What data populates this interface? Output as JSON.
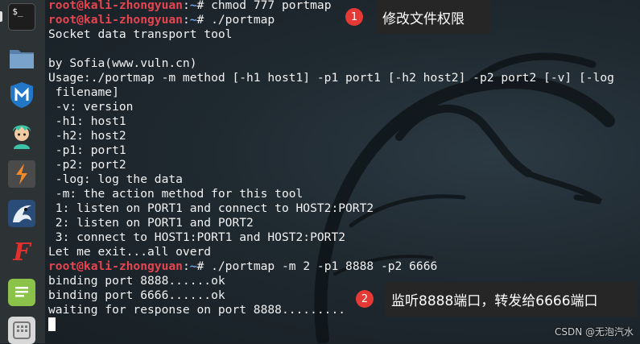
{
  "dock": {
    "items": [
      {
        "name": "terminal-icon",
        "label": "$_"
      },
      {
        "name": "folder-icon"
      },
      {
        "name": "metasploit-icon"
      },
      {
        "name": "avatar-app-icon"
      },
      {
        "name": "burpsuite-icon"
      },
      {
        "name": "kali-dragon-app-icon"
      },
      {
        "name": "faraday-icon",
        "label": "F"
      },
      {
        "name": "text-editor-icon"
      },
      {
        "name": "app-grid-icon"
      }
    ]
  },
  "terminal": {
    "user": "root@kali-zhongyuan",
    "sep": ":",
    "path": "~",
    "prompt_symbol": "# ",
    "lines": [
      {
        "type": "prompt",
        "cmd": "chmod 777 portmap"
      },
      {
        "type": "prompt",
        "cmd": "./portmap"
      },
      {
        "type": "out",
        "text": "Socket data transport tool"
      },
      {
        "type": "out",
        "text": ""
      },
      {
        "type": "out",
        "text": "by Sofia(www.vuln.cn)"
      },
      {
        "type": "out",
        "text": "Usage:./portmap -m method [-h1 host1] -p1 port1 [-h2 host2] -p2 port2 [-v] [-log"
      },
      {
        "type": "out",
        "text": " filename]"
      },
      {
        "type": "out",
        "text": " -v: version"
      },
      {
        "type": "out",
        "text": " -h1: host1"
      },
      {
        "type": "out",
        "text": " -h2: host2"
      },
      {
        "type": "out",
        "text": " -p1: port1"
      },
      {
        "type": "out",
        "text": " -p2: port2"
      },
      {
        "type": "out",
        "text": " -log: log the data"
      },
      {
        "type": "out",
        "text": " -m: the action method for this tool"
      },
      {
        "type": "out",
        "text": " 1: listen on PORT1 and connect to HOST2:PORT2"
      },
      {
        "type": "out",
        "text": " 2: listen on PORT1 and PORT2"
      },
      {
        "type": "out",
        "text": " 3: connect to HOST1:PORT1 and HOST2:PORT2"
      },
      {
        "type": "out",
        "text": "Let me exit...all overd"
      },
      {
        "type": "prompt",
        "cmd": "./portmap -m 2 -p1 8888 -p2 6666"
      },
      {
        "type": "out",
        "text": "binding port 8888......ok"
      },
      {
        "type": "out",
        "text": "binding port 6666......ok"
      },
      {
        "type": "out",
        "text": "waiting for response on port 8888........."
      },
      {
        "type": "cursor"
      }
    ]
  },
  "annotations": [
    {
      "num": "1",
      "text": "修改文件权限"
    },
    {
      "num": "2",
      "text": "监听8888端口，转发给6666端口"
    }
  ],
  "watermark": "CSDN @无泡汽水",
  "colors": {
    "user": "#e64550",
    "path": "#6fa0e8",
    "badge": "#e53935",
    "annotation_bg": "#262626"
  }
}
